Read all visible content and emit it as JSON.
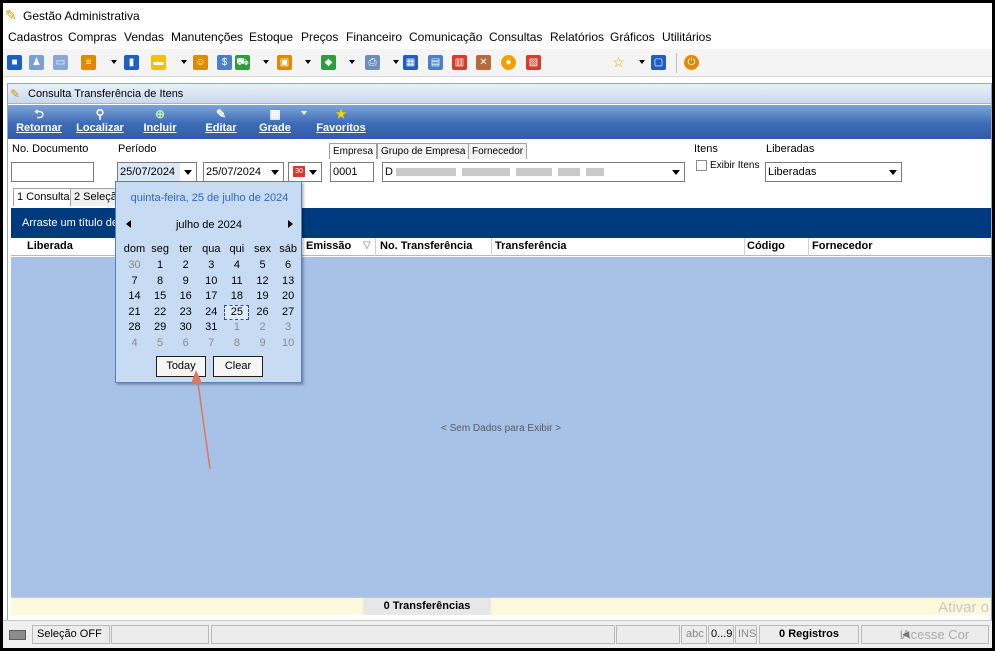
{
  "app": {
    "title": "Gestão Administrativa"
  },
  "menu": [
    "Cadastros",
    "Compras",
    "Vendas",
    "Manutenções",
    "Estoque",
    "Preços",
    "Financeiro",
    "Comunicação",
    "Consultas",
    "Relatórios",
    "Gráficos",
    "Utilitários"
  ],
  "toolbar": {
    "icons": [
      "customer-icon",
      "users-icon",
      "card-icon",
      "list-icon",
      "document-icon",
      "folder-icon",
      "person-icon",
      "invoice-icon",
      "cart-icon",
      "box-icon",
      "truck-icon",
      "printer-icon",
      "grid-icon",
      "calculator-icon",
      "calendar-icon",
      "tools-icon",
      "coin-icon",
      "report-icon",
      "star-icon",
      "window-icon",
      "power-icon"
    ],
    "colors": {
      "blue": "#1f5fbf",
      "orange": "#e08a00",
      "green": "#2e9e3c",
      "red": "#d73b2b",
      "yellow": "#f2c200"
    }
  },
  "window": {
    "title": "Consulta Transferência de Itens",
    "actions": [
      {
        "label": "Retornar",
        "icon": "return-icon"
      },
      {
        "label": "Localizar",
        "icon": "search-icon"
      },
      {
        "label": "Incluir",
        "icon": "add-icon"
      },
      {
        "label": "Editar",
        "icon": "edit-icon"
      },
      {
        "label": "Grade",
        "icon": "grid-icon"
      },
      {
        "label": "Favoritos",
        "icon": "star-icon"
      }
    ]
  },
  "filters": {
    "doc_label": "No. Documento",
    "doc_value": "",
    "period_label": "Período",
    "date_from": "25/07/2024",
    "date_to": "25/07/2024",
    "empresa_tabs": [
      "Empresa",
      "Grupo de Empresa",
      "Fornecedor"
    ],
    "empresa_code": "0001",
    "empresa_name": "D",
    "itens_label": "Itens",
    "exibir_itens": "Exibir Itens",
    "liberadas_label": "Liberadas",
    "liberadas_value": "Liberadas"
  },
  "tabs": [
    "1 Consulta",
    "2 Seleção"
  ],
  "grid": {
    "group_hint": "Arraste um título de co",
    "columns": [
      "Liberada",
      "Emissão",
      "No. Transferência",
      "Transferência",
      "Código",
      "Fornecedor"
    ],
    "empty_text": "< Sem Dados para Exibir >",
    "footer_count": "0 Transferências",
    "watermark": "Ativar o"
  },
  "statusbar": {
    "selecao": "Seleção OFF",
    "abc": "abc",
    "range": "0...9",
    "ins": "INS",
    "registros": "0 Registros",
    "acesse": "Acesse Cor"
  },
  "calendar": {
    "full_date": "quinta-feira, 25 de julho de 2024",
    "month_label": "julho de 2024",
    "weekdays": [
      "dom",
      "seg",
      "ter",
      "qua",
      "qui",
      "sex",
      "sáb"
    ],
    "days": [
      [
        "30",
        "1",
        "2",
        "3",
        "4",
        "5",
        "6"
      ],
      [
        "7",
        "8",
        "9",
        "10",
        "11",
        "12",
        "13"
      ],
      [
        "14",
        "15",
        "16",
        "17",
        "18",
        "19",
        "20"
      ],
      [
        "21",
        "22",
        "23",
        "24",
        "25",
        "26",
        "27"
      ],
      [
        "28",
        "29",
        "30",
        "31",
        "1",
        "2",
        "3"
      ],
      [
        "4",
        "5",
        "6",
        "7",
        "8",
        "9",
        "10"
      ]
    ],
    "selected": "25",
    "today_label": "Today",
    "clear_label": "Clear",
    "arrow_color": "#e0765c"
  }
}
